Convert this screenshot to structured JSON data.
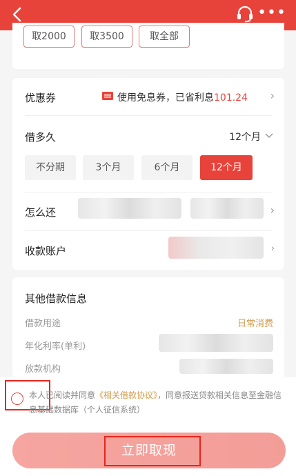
{
  "header": {
    "back_icon": "chevron-left-icon",
    "service_icon": "headset-icon",
    "more_icon": "more-dots-icon",
    "background": "#e8433a"
  },
  "amount_buttons": [
    "取2000",
    "取3500",
    "取全部"
  ],
  "coupon": {
    "label": "优惠券",
    "text": "使用免息券，已省利息",
    "value": "101.24",
    "icon": "ticket-icon"
  },
  "term": {
    "label": "借多久",
    "value": "12个月",
    "options": [
      "不分期",
      "3个月",
      "6个月",
      "12个月"
    ],
    "selected": "12个月"
  },
  "repay": {
    "label": "怎么还"
  },
  "account": {
    "label": "收款账户"
  },
  "info": {
    "title": "其他借款信息",
    "purpose_label": "借款用途",
    "purpose_value": "日常消费",
    "rate_label": "年化利率(单利)",
    "lender_label": "放款机构"
  },
  "agreement": {
    "prefix": "本人已阅读并同意",
    "link": "《相关借款协议》",
    "suffix": "，同意报送贷款相关信息至金融信息基础数据库（个人征信系统）"
  },
  "submit_label": "立即取现",
  "colors": {
    "accent": "#e8433a",
    "link": "#d29a4a"
  }
}
